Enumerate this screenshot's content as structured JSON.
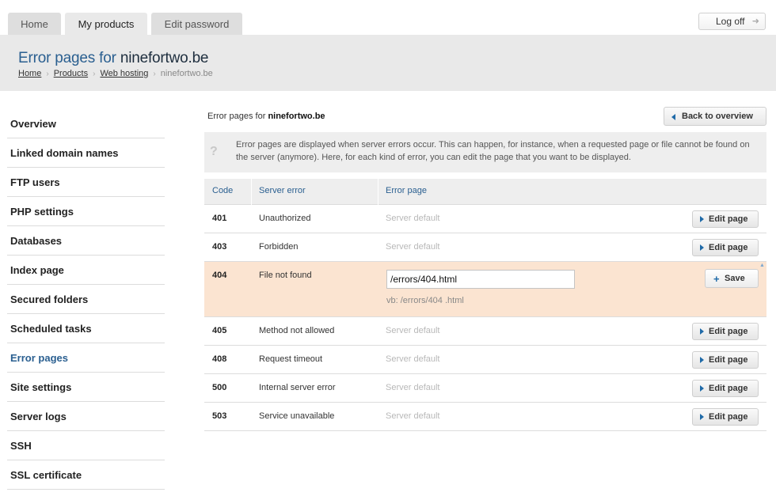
{
  "tabs": [
    {
      "label": "Home"
    },
    {
      "label": "My products"
    },
    {
      "label": "Edit password"
    }
  ],
  "logoff_label": "Log off",
  "header": {
    "title_prefix": "Error pages for",
    "title_domain": "ninefortwo.be",
    "breadcrumb": [
      "Home",
      "Products",
      "Web hosting",
      "ninefortwo.be"
    ]
  },
  "sidebar": {
    "items": [
      {
        "label": "Overview"
      },
      {
        "label": "Linked domain names"
      },
      {
        "label": "FTP users"
      },
      {
        "label": "PHP settings"
      },
      {
        "label": "Databases"
      },
      {
        "label": "Index page"
      },
      {
        "label": "Secured folders"
      },
      {
        "label": "Scheduled tasks"
      },
      {
        "label": "Error pages"
      },
      {
        "label": "Site settings"
      },
      {
        "label": "Server logs"
      },
      {
        "label": "SSH"
      },
      {
        "label": "SSL certificate"
      }
    ],
    "active": "Error pages"
  },
  "main": {
    "heading_prefix": "Error pages for",
    "heading_domain": "ninefortwo.be",
    "back_label": "Back to overview",
    "info_text": "Error pages are displayed when server errors occur. This can happen, for instance, when a requested page or file cannot be found on the server (anymore). Here, for each kind of error, you can edit the page that you want to be displayed.",
    "columns": {
      "code": "Code",
      "server_error": "Server error",
      "error_page": "Error page"
    },
    "edit_label": "Edit page",
    "save_label": "Save",
    "rows": [
      {
        "code": "401",
        "error": "Unauthorized",
        "page": "Server default"
      },
      {
        "code": "403",
        "error": "Forbidden",
        "page": "Server default"
      },
      {
        "code": "404",
        "error": "File not found",
        "value": "/errors/404.html",
        "hint": "vb: /errors/404 .html"
      },
      {
        "code": "405",
        "error": "Method not allowed",
        "page": "Server default"
      },
      {
        "code": "408",
        "error": "Request timeout",
        "page": "Server default"
      },
      {
        "code": "500",
        "error": "Internal server error",
        "page": "Server default"
      },
      {
        "code": "503",
        "error": "Service unavailable",
        "page": "Server default"
      }
    ]
  },
  "colors": {
    "accent": "#2a5f90",
    "editing_row": "#fbe4d1",
    "header_bg": "#e9e9e9"
  }
}
